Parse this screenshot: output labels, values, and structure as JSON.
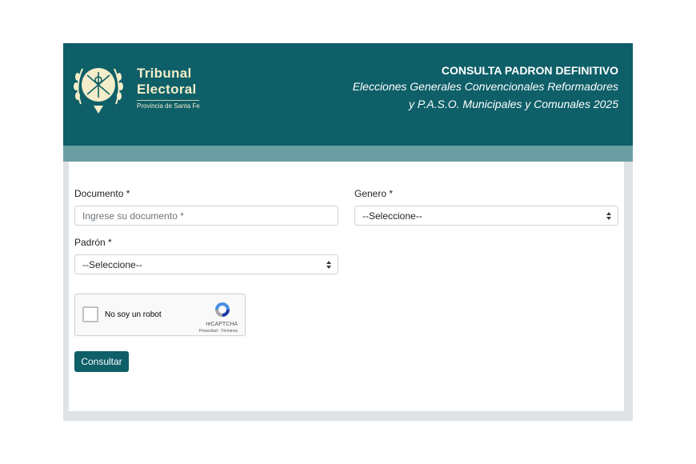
{
  "header": {
    "brand_line1": "Tribunal",
    "brand_line2": "Electoral",
    "brand_line3": "Provincia de Santa Fe",
    "title": "CONSULTA PADRON DEFINITIVO",
    "subtitle_line1": "Elecciones Generales Convencionales Reformadores",
    "subtitle_line2": "y P.A.S.O. Municipales y Comunales 2025",
    "logo_icon": "santa-fe-coat-of-arms"
  },
  "form": {
    "documento_label": "Documento *",
    "documento_placeholder": "Ingrese su documento *",
    "genero_label": "Genero *",
    "genero_selected": "--Seleccione--",
    "padron_label": "Padrón *",
    "padron_selected": "--Seleccione--",
    "submit_label": "Consultar"
  },
  "recaptcha": {
    "label": "No soy un robot",
    "brand": "reCAPTCHA",
    "terms": "Privacidad - Términos"
  },
  "colors": {
    "header_bg": "#0e5f68",
    "band_bg": "#6a9ea2",
    "brand_text": "#f4edc9",
    "button_bg": "#0e5f68"
  }
}
